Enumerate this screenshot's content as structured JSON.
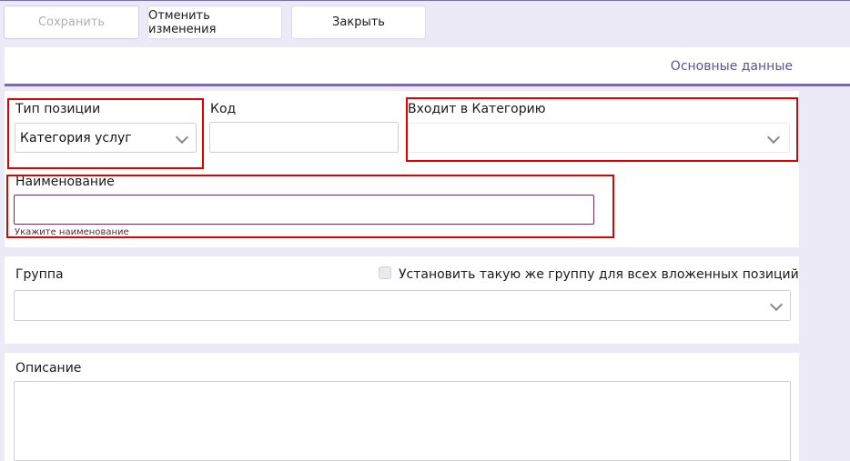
{
  "toolbar": {
    "save_label": "Сохранить",
    "cancel_label": "Отменить изменения",
    "close_label": "Закрыть"
  },
  "tabs": {
    "main_label": "Основные данные"
  },
  "form": {
    "position_type": {
      "label": "Тип позиции",
      "value": "Категория услуг"
    },
    "code": {
      "label": "Код",
      "value": ""
    },
    "category": {
      "label": "Входит в Категорию",
      "value": ""
    },
    "name": {
      "label": "Наименование",
      "value": "",
      "hint": "Укажите наименование"
    },
    "group": {
      "label": "Группа",
      "value": "",
      "apply_all_label": "Установить такую же группу для всех вложенных позиций"
    },
    "description": {
      "label": "Описание",
      "value": ""
    }
  },
  "colors": {
    "accent": "#7a6cab",
    "background": "#eceaf7",
    "highlight_red": "#e00000"
  },
  "icons": [
    "chevron-down-icon",
    "checkbox-icon"
  ]
}
